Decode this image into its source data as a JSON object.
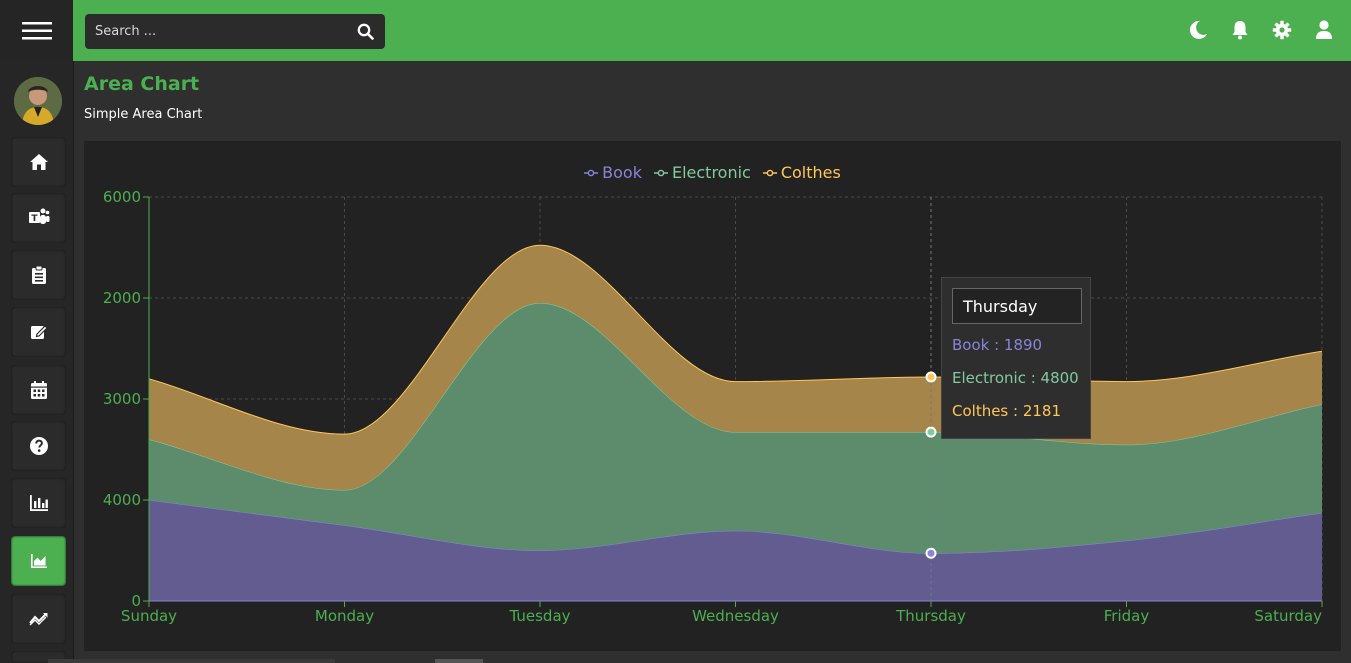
{
  "header": {
    "search_placeholder": "Search ...",
    "icons": [
      "menu-icon",
      "search-icon",
      "moon-icon",
      "bell-icon",
      "gear-icon",
      "user-icon"
    ],
    "accent_color": "#4caf50"
  },
  "sidebar": {
    "items": [
      {
        "icon": "home-icon"
      },
      {
        "icon": "teams-icon"
      },
      {
        "icon": "clipboard-icon"
      },
      {
        "icon": "edit-icon"
      },
      {
        "icon": "calendar-icon"
      },
      {
        "icon": "help-icon"
      },
      {
        "icon": "bar-chart-icon"
      },
      {
        "icon": "area-chart-icon",
        "active": true
      },
      {
        "icon": "trend-icon"
      }
    ]
  },
  "page": {
    "title": "Area Chart",
    "subtitle": "Simple Area Chart"
  },
  "tooltip": {
    "title": "Thursday",
    "rows": [
      {
        "text": "Book : 1890",
        "color": "#8884d8"
      },
      {
        "text": "Electronic : 4800",
        "color": "#82ca9d"
      },
      {
        "text": "Colthes : 2181",
        "color": "#ffc658"
      }
    ]
  },
  "chart_data": {
    "type": "area",
    "stacked": true,
    "categories": [
      "Sunday",
      "Monday",
      "Tuesday",
      "Wednesday",
      "Thursday",
      "Friday",
      "Saturday"
    ],
    "series": [
      {
        "name": "Book",
        "values": [
          4000,
          3000,
          2000,
          2780,
          1890,
          2390,
          3490
        ],
        "color": "#8884d8"
      },
      {
        "name": "Electronic",
        "values": [
          2400,
          1398,
          9800,
          3908,
          4800,
          3800,
          4300
        ],
        "color": "#82ca9d"
      },
      {
        "name": "Colthes",
        "values": [
          2400,
          2210,
          2290,
          2000,
          2181,
          2500,
          2100
        ],
        "color": "#ffc658"
      }
    ],
    "yticks": [
      0,
      4000,
      8000,
      12000,
      16000
    ],
    "ytick_labels": [
      "0",
      "4000",
      "3000",
      "2000",
      "6000"
    ],
    "ylim": [
      0,
      16000
    ],
    "grid": true,
    "legend": "top-center",
    "active_category": "Thursday",
    "axis_color": "#4caf50"
  }
}
